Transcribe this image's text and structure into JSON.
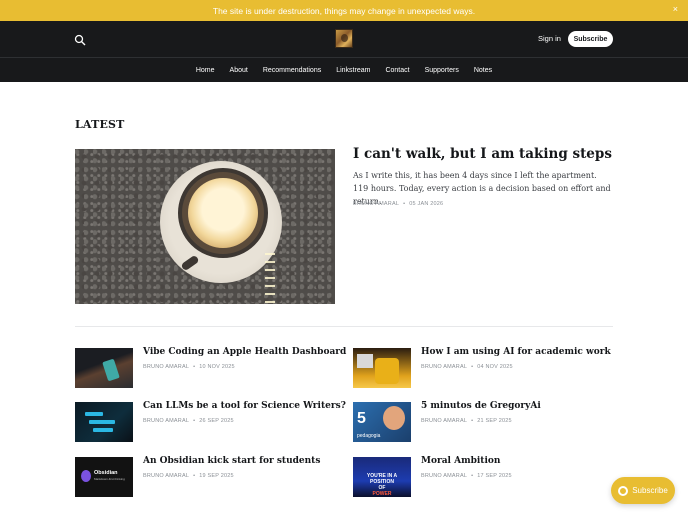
{
  "banner": {
    "text": "The site is under destruction, things may change in unexpected ways.",
    "close": "×"
  },
  "header": {
    "signin_label": "Sign in",
    "subscribe_label": "Subscribe",
    "nav": [
      "Home",
      "About",
      "Recommendations",
      "Linkstream",
      "Contact",
      "Supporters",
      "Notes"
    ]
  },
  "section_title": "LATEST",
  "featured": {
    "title": "I can't walk, but I am taking steps",
    "excerpt": "As I write this, it has been 4 days since I left the apartment. 119 hours. Today, every action is a decision based on effort and return.",
    "author": "BRUNO AMARAL",
    "date": "05 JAN 2026"
  },
  "posts": [
    {
      "title": "Vibe Coding an Apple Health Dashboard",
      "author": "BRUNO AMARAL",
      "date": "10 NOV 2025"
    },
    {
      "title": "How I am using AI for academic work",
      "author": "BRUNO AMARAL",
      "date": "04 NOV 2025"
    },
    {
      "title": "Can LLMs be a tool for Science Writers?",
      "author": "BRUNO AMARAL",
      "date": "26 SEP 2025"
    },
    {
      "title": "5 minutos de GregoryAi",
      "author": "BRUNO AMARAL",
      "date": "21 SEP 2025"
    },
    {
      "title": "An Obsidian kick start for students",
      "author": "BRUNO AMARAL",
      "date": "19 SEP 2025"
    },
    {
      "title": "Moral Ambition",
      "author": "BRUNO AMARAL",
      "date": "17 SEP 2025"
    }
  ],
  "thumb_text": {
    "gregory_number": "5",
    "gregory_caption": "pedagogia",
    "obsidian_name": "Obsidian",
    "obsidian_sub": "Markdown-first thinking",
    "moral_line1": "YOU'RE IN A POSITION",
    "moral_line2": "OF",
    "moral_line3": "POWER"
  },
  "floating_subscribe": "Subscribe",
  "colors": {
    "accent": "#e8bd32",
    "header_bg": "#18191b"
  }
}
